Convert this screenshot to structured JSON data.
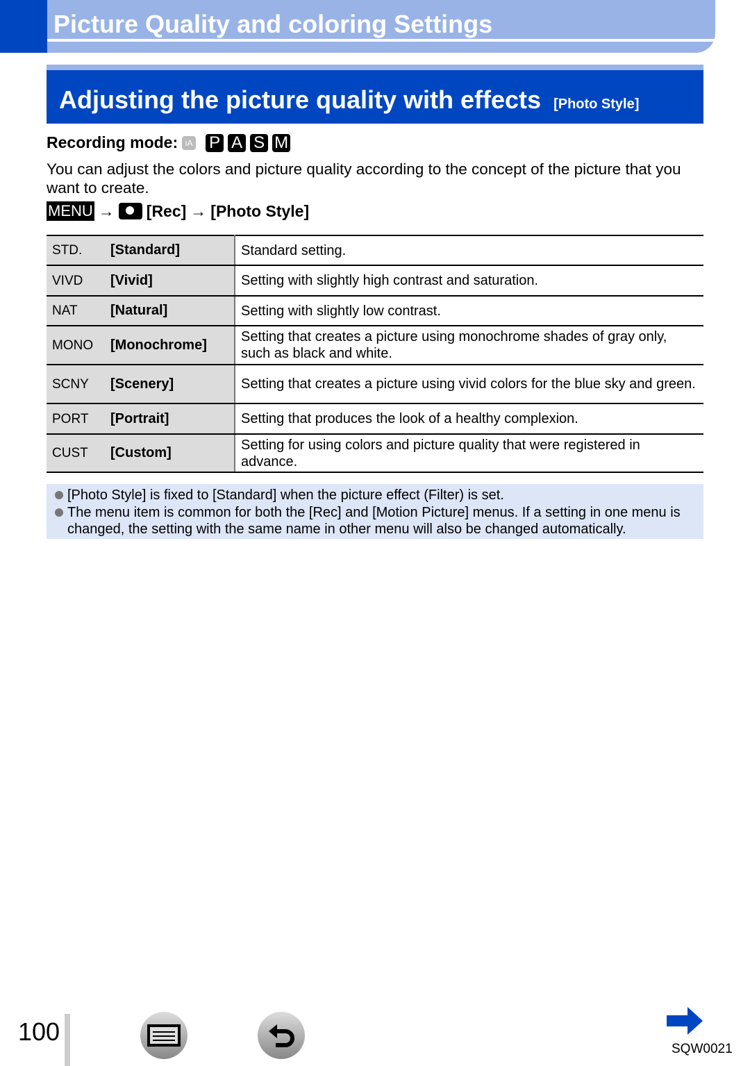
{
  "chapter_title": "Picture Quality and coloring Settings",
  "section": {
    "title": "Adjusting the picture quality with effects",
    "subtitle": "[Photo Style]"
  },
  "recording_mode": {
    "label": "Recording mode:",
    "modes": [
      "iA",
      "P",
      "A",
      "S",
      "M"
    ]
  },
  "intro": "You can adjust the colors and picture quality according to the concept of the picture that you want to create.",
  "menu_path": {
    "menu": "MENU",
    "arrow": "→",
    "rec": "[Rec]",
    "item": "[Photo Style]"
  },
  "styles": [
    {
      "icon": "STD.",
      "name": "[Standard]",
      "desc": "Standard setting."
    },
    {
      "icon": "VIVD",
      "name": "[Vivid]",
      "desc": "Setting with slightly high contrast and saturation."
    },
    {
      "icon": "NAT",
      "name": "[Natural]",
      "desc": "Setting with slightly low contrast."
    },
    {
      "icon": "MONO",
      "name": "[Monochrome]",
      "desc": "Setting that creates a picture using monochrome shades of gray only, such as black and white."
    },
    {
      "icon": "SCNY",
      "name": "[Scenery]",
      "desc": "Setting that creates a picture using vivid colors for the blue sky and green."
    },
    {
      "icon": "PORT",
      "name": "[Portrait]",
      "desc": "Setting that produces the look of a healthy complexion."
    },
    {
      "icon": "CUST",
      "name": "[Custom]",
      "desc": "Setting for using colors and picture quality that were registered in advance."
    }
  ],
  "notes": [
    "[Photo Style] is fixed to [Standard] when the picture effect (Filter) is set.",
    "The menu item is common for both the [Rec] and [Motion Picture] menus. If a setting in one menu is changed, the setting with the same name in other menu will also be changed automatically."
  ],
  "footer": {
    "page": "100",
    "code": "SQW0021"
  },
  "colors": {
    "brand": "#0046c0",
    "light": "#99b3e6"
  }
}
